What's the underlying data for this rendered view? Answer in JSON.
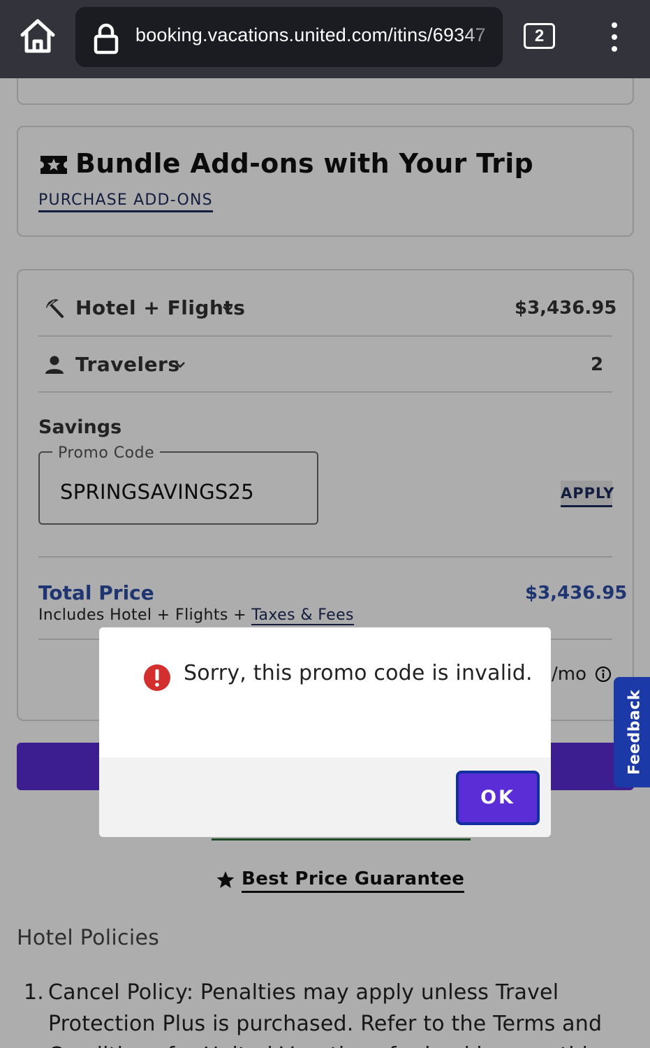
{
  "browser": {
    "url": "booking.vacations.united.com/itins/69347",
    "tab_count": "2"
  },
  "addons": {
    "title": "Bundle Add-ons with Your Trip",
    "link": "PURCHASE ADD-ONS"
  },
  "summary": {
    "hotel_flights_label": "Hotel + Flights",
    "hotel_flights_value": "$3,436.95",
    "travelers_label": "Travelers",
    "travelers_value": "2",
    "savings_label": "Savings",
    "promo_label": "Promo Code",
    "promo_value": "SPRINGSAVINGS25",
    "apply_label": "APPLY",
    "total_label": "Total Price",
    "total_value": "$3,436.95",
    "includes_prefix": "Includes Hotel + Flights + ",
    "includes_link": "Taxes & Fees",
    "monthly_suffix": "/mo"
  },
  "footer": {
    "best_price": "Best Price Guarantee",
    "policies_title": "Hotel Policies",
    "policy_num": "1.",
    "policy_text": "Cancel Policy: Penalties may apply unless Travel Protection Plus is purchased. Refer to the Terms and Conditions for United Vacations for bookings on this"
  },
  "feedback": {
    "label": "Feedback"
  },
  "dialog": {
    "message": "Sorry, this promo code is invalid.",
    "ok_label": "OK"
  },
  "colors": {
    "accent_purple": "#5a2dd6",
    "link_navy": "#1d2b5a",
    "price_blue": "#2e4fa8",
    "error_red": "#d32f2f",
    "feedback_blue": "#1b3aa8"
  }
}
